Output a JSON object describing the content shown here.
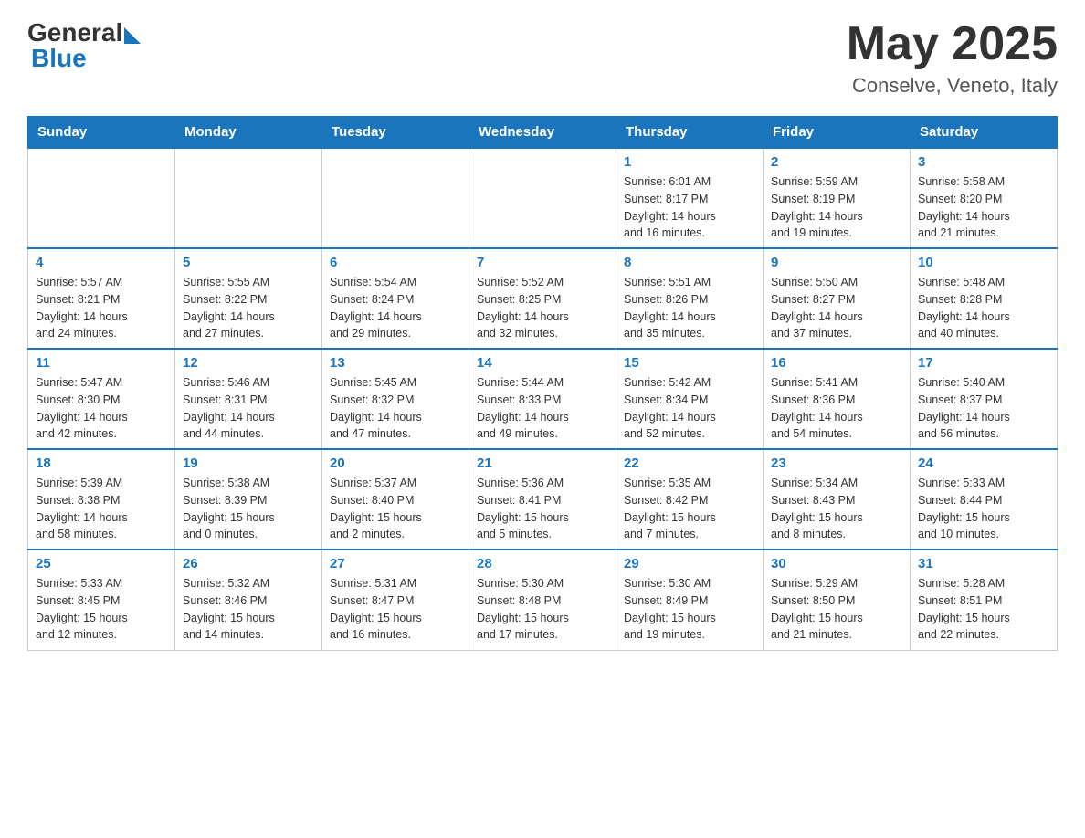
{
  "header": {
    "logo": {
      "general": "General",
      "blue": "Blue"
    },
    "title": "May 2025",
    "location": "Conselve, Veneto, Italy"
  },
  "weekdays": [
    "Sunday",
    "Monday",
    "Tuesday",
    "Wednesday",
    "Thursday",
    "Friday",
    "Saturday"
  ],
  "weeks": [
    [
      {
        "day": "",
        "info": ""
      },
      {
        "day": "",
        "info": ""
      },
      {
        "day": "",
        "info": ""
      },
      {
        "day": "",
        "info": ""
      },
      {
        "day": "1",
        "info": "Sunrise: 6:01 AM\nSunset: 8:17 PM\nDaylight: 14 hours\nand 16 minutes."
      },
      {
        "day": "2",
        "info": "Sunrise: 5:59 AM\nSunset: 8:19 PM\nDaylight: 14 hours\nand 19 minutes."
      },
      {
        "day": "3",
        "info": "Sunrise: 5:58 AM\nSunset: 8:20 PM\nDaylight: 14 hours\nand 21 minutes."
      }
    ],
    [
      {
        "day": "4",
        "info": "Sunrise: 5:57 AM\nSunset: 8:21 PM\nDaylight: 14 hours\nand 24 minutes."
      },
      {
        "day": "5",
        "info": "Sunrise: 5:55 AM\nSunset: 8:22 PM\nDaylight: 14 hours\nand 27 minutes."
      },
      {
        "day": "6",
        "info": "Sunrise: 5:54 AM\nSunset: 8:24 PM\nDaylight: 14 hours\nand 29 minutes."
      },
      {
        "day": "7",
        "info": "Sunrise: 5:52 AM\nSunset: 8:25 PM\nDaylight: 14 hours\nand 32 minutes."
      },
      {
        "day": "8",
        "info": "Sunrise: 5:51 AM\nSunset: 8:26 PM\nDaylight: 14 hours\nand 35 minutes."
      },
      {
        "day": "9",
        "info": "Sunrise: 5:50 AM\nSunset: 8:27 PM\nDaylight: 14 hours\nand 37 minutes."
      },
      {
        "day": "10",
        "info": "Sunrise: 5:48 AM\nSunset: 8:28 PM\nDaylight: 14 hours\nand 40 minutes."
      }
    ],
    [
      {
        "day": "11",
        "info": "Sunrise: 5:47 AM\nSunset: 8:30 PM\nDaylight: 14 hours\nand 42 minutes."
      },
      {
        "day": "12",
        "info": "Sunrise: 5:46 AM\nSunset: 8:31 PM\nDaylight: 14 hours\nand 44 minutes."
      },
      {
        "day": "13",
        "info": "Sunrise: 5:45 AM\nSunset: 8:32 PM\nDaylight: 14 hours\nand 47 minutes."
      },
      {
        "day": "14",
        "info": "Sunrise: 5:44 AM\nSunset: 8:33 PM\nDaylight: 14 hours\nand 49 minutes."
      },
      {
        "day": "15",
        "info": "Sunrise: 5:42 AM\nSunset: 8:34 PM\nDaylight: 14 hours\nand 52 minutes."
      },
      {
        "day": "16",
        "info": "Sunrise: 5:41 AM\nSunset: 8:36 PM\nDaylight: 14 hours\nand 54 minutes."
      },
      {
        "day": "17",
        "info": "Sunrise: 5:40 AM\nSunset: 8:37 PM\nDaylight: 14 hours\nand 56 minutes."
      }
    ],
    [
      {
        "day": "18",
        "info": "Sunrise: 5:39 AM\nSunset: 8:38 PM\nDaylight: 14 hours\nand 58 minutes."
      },
      {
        "day": "19",
        "info": "Sunrise: 5:38 AM\nSunset: 8:39 PM\nDaylight: 15 hours\nand 0 minutes."
      },
      {
        "day": "20",
        "info": "Sunrise: 5:37 AM\nSunset: 8:40 PM\nDaylight: 15 hours\nand 2 minutes."
      },
      {
        "day": "21",
        "info": "Sunrise: 5:36 AM\nSunset: 8:41 PM\nDaylight: 15 hours\nand 5 minutes."
      },
      {
        "day": "22",
        "info": "Sunrise: 5:35 AM\nSunset: 8:42 PM\nDaylight: 15 hours\nand 7 minutes."
      },
      {
        "day": "23",
        "info": "Sunrise: 5:34 AM\nSunset: 8:43 PM\nDaylight: 15 hours\nand 8 minutes."
      },
      {
        "day": "24",
        "info": "Sunrise: 5:33 AM\nSunset: 8:44 PM\nDaylight: 15 hours\nand 10 minutes."
      }
    ],
    [
      {
        "day": "25",
        "info": "Sunrise: 5:33 AM\nSunset: 8:45 PM\nDaylight: 15 hours\nand 12 minutes."
      },
      {
        "day": "26",
        "info": "Sunrise: 5:32 AM\nSunset: 8:46 PM\nDaylight: 15 hours\nand 14 minutes."
      },
      {
        "day": "27",
        "info": "Sunrise: 5:31 AM\nSunset: 8:47 PM\nDaylight: 15 hours\nand 16 minutes."
      },
      {
        "day": "28",
        "info": "Sunrise: 5:30 AM\nSunset: 8:48 PM\nDaylight: 15 hours\nand 17 minutes."
      },
      {
        "day": "29",
        "info": "Sunrise: 5:30 AM\nSunset: 8:49 PM\nDaylight: 15 hours\nand 19 minutes."
      },
      {
        "day": "30",
        "info": "Sunrise: 5:29 AM\nSunset: 8:50 PM\nDaylight: 15 hours\nand 21 minutes."
      },
      {
        "day": "31",
        "info": "Sunrise: 5:28 AM\nSunset: 8:51 PM\nDaylight: 15 hours\nand 22 minutes."
      }
    ]
  ]
}
